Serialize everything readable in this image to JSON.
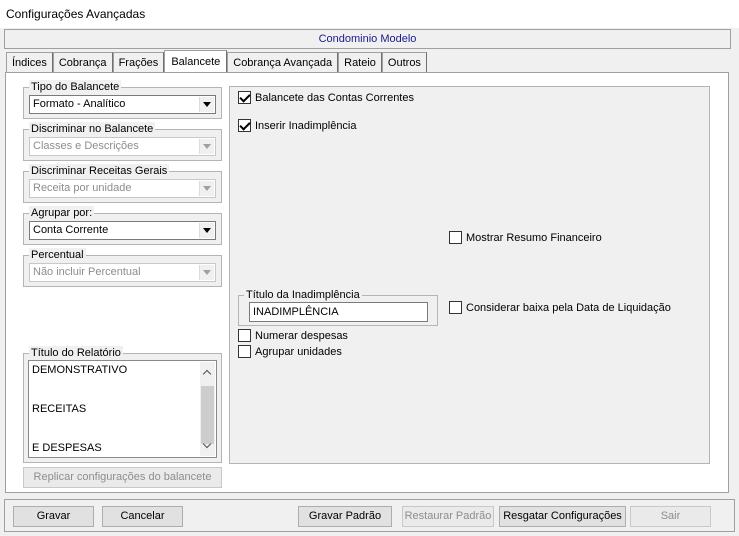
{
  "window": {
    "title": "Configurações Avançadas"
  },
  "header": {
    "condominio": "Condominio Modelo"
  },
  "tabs": [
    {
      "label": "Índices",
      "active": false
    },
    {
      "label": "Cobrança",
      "active": false
    },
    {
      "label": "Frações",
      "active": false
    },
    {
      "label": "Balancete",
      "active": true
    },
    {
      "label": "Cobrança Avançada",
      "active": false
    },
    {
      "label": "Rateio",
      "active": false
    },
    {
      "label": "Outros",
      "active": false
    }
  ],
  "left": {
    "tipo_balancete": {
      "label": "Tipo do Balancete",
      "value": "Formato - Analítico"
    },
    "discriminar_balancete": {
      "label": "Discriminar no Balancete",
      "value": "Classes e Descrições"
    },
    "discriminar_receitas": {
      "label": "Discriminar Receitas Gerais",
      "value": "Receita por unidade"
    },
    "agrupar_por": {
      "label": "Agrupar por:",
      "value": "Conta Corrente"
    },
    "percentual": {
      "label": "Percentual",
      "value": "Não incluir Percentual"
    },
    "titulo_relatorio": {
      "label": "Título do Relatório",
      "lines": [
        "DEMONSTRATIVO",
        "RECEITAS",
        "E DESPESAS"
      ]
    },
    "replicar_button": "Replicar configurações do balancete"
  },
  "right": {
    "balancete_contas": {
      "label": "Balancete das Contas Correntes",
      "checked": true
    },
    "inserir_inadimplencia": {
      "label": "Inserir Inadimplência",
      "checked": true
    },
    "mostrar_resumo": {
      "label": "Mostrar Resumo Financeiro",
      "checked": false
    },
    "titulo_inadimplencia": {
      "label": "Título da Inadimplência",
      "value": "INADIMPLÊNCIA"
    },
    "considerar_baixa": {
      "label": "Considerar baixa pela Data de Liquidação",
      "checked": false
    },
    "numerar_despesas": {
      "label": "Numerar despesas",
      "checked": false
    },
    "agrupar_unidades": {
      "label": "Agrupar unidades",
      "checked": false
    }
  },
  "buttons": {
    "gravar": "Gravar",
    "cancelar": "Cancelar",
    "gravar_padrao": "Gravar Padrão",
    "restaurar_padrao": "Restaurar Padrão",
    "resgatar_configuracoes": "Resgatar Configurações",
    "sair": "Sair"
  }
}
